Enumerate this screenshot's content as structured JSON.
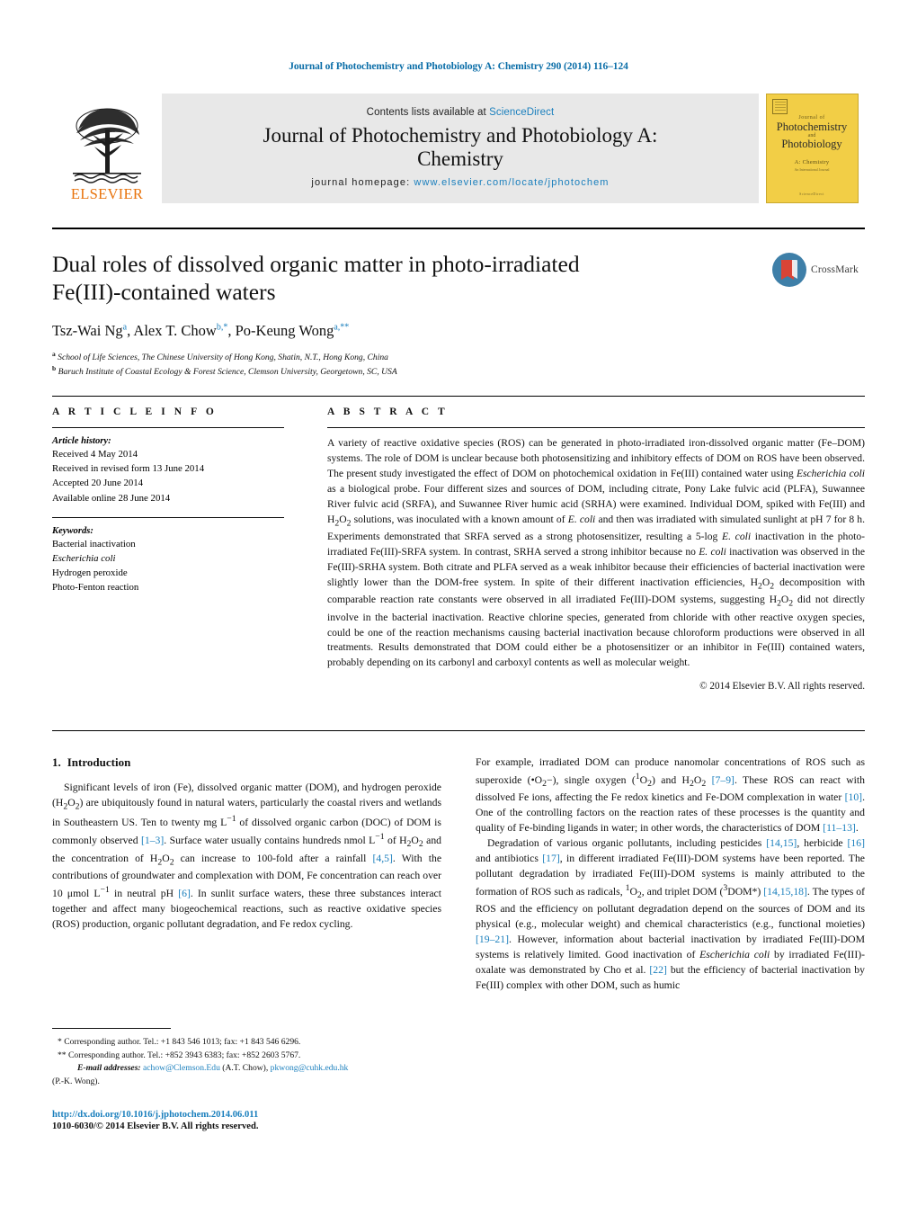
{
  "running_head": "Journal of Photochemistry and Photobiology A: Chemistry 290 (2014) 116–124",
  "masthead": {
    "publisher_logo_text": "ELSEVIER",
    "contents_prefix": "Contents lists available at",
    "contents_link": "ScienceDirect",
    "journal_title_line1": "Journal of Photochemistry and Photobiology A:",
    "journal_title_line2": "Chemistry",
    "homepage_label": "journal homepage:",
    "homepage_url": "www.elsevier.com/locate/jphotochem",
    "cover": {
      "superline": "Journal of",
      "line1": "Photochemistry",
      "and": "and",
      "line2": "Photobiology",
      "subtitle": "A: Chemistry",
      "subtitle2": "An International Journal",
      "footer": "ScienceDirect"
    }
  },
  "article": {
    "title_line1": "Dual roles of dissolved organic matter in photo-irradiated",
    "title_line2": "Fe(III)-contained waters",
    "authors": [
      {
        "name": "Tsz-Wai Ng",
        "marks": "a"
      },
      {
        "name": "Alex T. Chow",
        "marks": "b,*"
      },
      {
        "name": "Po-Keung Wong",
        "marks": "a,**"
      }
    ],
    "affiliations": [
      {
        "mark": "a",
        "text": "School of Life Sciences, The Chinese University of Hong Kong, Shatin, N.T., Hong Kong, China"
      },
      {
        "mark": "b",
        "text": "Baruch Institute of Coastal Ecology & Forest Science, Clemson University, Georgetown, SC, USA"
      }
    ],
    "crossmark_label": "CrossMark"
  },
  "article_info": {
    "heading": "A R T I C L E   I N F O",
    "history_label": "Article history:",
    "history": [
      "Received 4 May 2014",
      "Received in revised form 13 June 2014",
      "Accepted 20 June 2014",
      "Available online 28 June 2014"
    ],
    "keywords_label": "Keywords:",
    "keywords": [
      "Bacterial inactivation",
      "Escherichia coli",
      "Hydrogen peroxide",
      "Photo-Fenton reaction"
    ],
    "keywords_italic_index": 1
  },
  "abstract": {
    "heading": "A B S T R A C T",
    "text_part1": "A variety of reactive oxidative species (ROS) can be generated in photo-irradiated iron-dissolved organic matter (Fe–DOM) systems. The role of DOM is unclear because both photosensitizing and inhibitory effects of DOM on ROS have been observed. The present study investigated the effect of DOM on photochemical oxidation in Fe(III) contained water using ",
    "italic1": "Escherichia coli",
    "text_part2": " as a biological probe. Four different sizes and sources of DOM, including citrate, Pony Lake fulvic acid (PLFA), Suwannee River fulvic acid (SRFA), and Suwannee River humic acid (SRHA) were examined. Individual DOM, spiked with Fe(III) and H",
    "sub1": "2",
    "text_part3": "O",
    "sub2": "2",
    "text_part4": " solutions, was inoculated with a known amount of ",
    "italic2": "E. coli",
    "text_part5": " and then was irradiated with simulated sunlight at pH 7 for 8 h. Experiments demonstrated that SRFA served as a strong photosensitizer, resulting a 5-log ",
    "italic3": "E. coli",
    "text_part6": " inactivation in the photo-irradiated Fe(III)-SRFA system. In contrast, SRHA served a strong inhibitor because no ",
    "italic4": "E. coli",
    "text_part7": " inactivation was observed in the Fe(III)-SRHA system. Both citrate and PLFA served as a weak inhibitor because their efficiencies of bacterial inactivation were slightly lower than the DOM-free system. In spite of their different inactivation efficiencies, H",
    "text_part8": "O",
    "text_part9": " decomposition with comparable reaction rate constants were observed in all irradiated Fe(III)-DOM systems, suggesting H",
    "text_part10": "O",
    "text_part11": " did not directly involve in the bacterial inactivation. Reactive chlorine species, generated from chloride with other reactive oxygen species, could be one of the reaction mechanisms causing bacterial inactivation because chloroform productions were observed in all treatments. Results demonstrated that DOM could either be a photosensitizer or an inhibitor in Fe(III) contained waters, probably depending on its carbonyl and carboxyl contents as well as molecular weight.",
    "copyright": "© 2014 Elsevier B.V. All rights reserved."
  },
  "introduction": {
    "number": "1.",
    "heading": "Introduction",
    "left_para1_a": "Significant levels of iron (Fe), dissolved organic matter (DOM), and hydrogen peroxide (H",
    "left_para1_b": "O",
    "left_para1_c": ") are ubiquitously found in natural waters, particularly the coastal rivers and wetlands in Southeastern US. Ten to twenty mg L",
    "left_sup1": "−1",
    "left_para1_d": " of dissolved organic carbon (DOC) of DOM is commonly observed ",
    "ref1": "[1–3]",
    "left_para1_e": ". Surface water usually contains hundreds nmol L",
    "left_sup2": "−1",
    "left_para1_f": " of H",
    "left_para1_g": "O",
    "left_para1_h": " and the concentration of H",
    "left_para1_i": "O",
    "left_para1_j": " can increase to 100-fold after a rainfall ",
    "ref2": "[4,5]",
    "left_para1_k": ". With the contributions of groundwater and complexation with DOM, Fe concentration can reach over 10 μmol L",
    "left_sup3": "−1",
    "left_para1_l": " in neutral pH ",
    "ref3": "[6]",
    "left_para1_m": ". In sunlit surface waters, these three substances interact together and affect many biogeochemical reactions, such as reactive oxidative species (ROS) production, organic pollutant degradation, and Fe redox cycling.",
    "right_para1_a": "For example, irradiated DOM can produce nanomolar concentrations of ROS such as superoxide (•O",
    "right_para1_b": "−), single oxygen (",
    "right_sup_1": "1",
    "right_para1_c": "O",
    "right_para1_d": ") and H",
    "right_para1_e": "O",
    "right_para1_f": " ",
    "ref4": "[7–9]",
    "right_para1_g": ". These ROS can react with dissolved Fe ions, affecting the Fe redox kinetics and Fe-DOM complexation in water ",
    "ref5": "[10]",
    "right_para1_h": ". One of the controlling factors on the reaction rates of these processes is the quantity and quality of Fe-binding ligands in water; in other words, the characteristics of DOM ",
    "ref6": "[11–13]",
    "right_para1_i": ".",
    "right_para2_a": "Degradation of various organic pollutants, including pesticides ",
    "ref7": "[14,15]",
    "right_para2_b": ", herbicide ",
    "ref8": "[16]",
    "right_para2_c": " and antibiotics ",
    "ref9": "[17]",
    "right_para2_d": ", in different irradiated Fe(III)-DOM systems have been reported. The pollutant degradation by irradiated Fe(III)-DOM systems is mainly attributed to the formation of ROS such as radicals, ",
    "right_sup_2": "1",
    "right_para2_e": "O",
    "right_para2_f": ", and triplet DOM (",
    "right_sup_3": "3",
    "right_para2_g": "DOM*) ",
    "ref10": "[14,15,18]",
    "right_para2_h": ". The types of ROS and the efficiency on pollutant degradation depend on the sources of DOM and its physical (e.g., molecular weight) and chemical characteristics (e.g., functional moieties) ",
    "ref11": "[19–21]",
    "right_para2_i": ". However, information about bacterial inactivation by irradiated Fe(III)-DOM systems is relatively limited. Good inactivation of ",
    "italic_ecoli": "Escherichia coli",
    "right_para2_j": " by irradiated Fe(III)-oxalate was demonstrated by Cho et al. ",
    "ref12": "[22]",
    "right_para2_k": " but the efficiency of bacterial inactivation by Fe(III) complex with other DOM, such as humic"
  },
  "footnotes": {
    "line1_mark": "*",
    "line1": "Corresponding author. Tel.: +1 843 546 1013; fax: +1 843 546 6296.",
    "line2_mark": "**",
    "line2": "Corresponding author. Tel.: +852 3943 6383; fax: +852 2603 5767.",
    "email_label": "E-mail addresses:",
    "email1": "achow@Clemson.Edu",
    "email1_who": "(A.T. Chow),",
    "email2": "pkwong@cuhk.edu.hk",
    "email2_who": "(P.-K. Wong).",
    "doi": "http://dx.doi.org/10.1016/j.jphotochem.2014.06.011",
    "issn": "1010-6030/© 2014 Elsevier B.V. All rights reserved."
  },
  "colors": {
    "link": "#1a7fbd",
    "elsevier_orange": "#E8730C",
    "cover_yellow": "#F2CE46",
    "banner_grey": "#e8e8e8"
  }
}
